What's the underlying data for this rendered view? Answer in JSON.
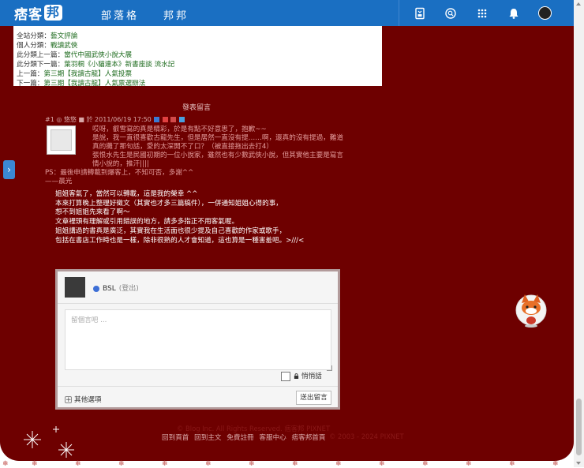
{
  "topbar": {
    "logo_text": "痞客",
    "logo_box": "邦",
    "nav": [
      "部落格",
      "邦邦"
    ],
    "icons": [
      "bookmark-icon",
      "search-icon",
      "apps-grid-icon",
      "notification-bell-icon",
      "user-avatar"
    ]
  },
  "info_panel": {
    "site_category_label": "全站分類：",
    "site_category": "藝文評論",
    "personal_category_label": "個人分類：",
    "personal_category": "戰讀武俠",
    "prev_in_category_label": "此分類上一篇：",
    "prev_in_category": "當代中國武俠小說大展",
    "next_in_category_label": "此分類下一篇：",
    "next_in_category": "葉羽桐《小貓連本》新書座談 流水記",
    "prev_label": "上一篇：",
    "prev": "第三期【我讀古龍】人氣投票",
    "next_label": "下一篇：",
    "next": "第三期【我讀古龍】人氣票選辦法"
  },
  "comments_title": "發表留言",
  "comment": {
    "meta": "#1 ◎ 悠悠 ■ 於 2011/06/19 17:50",
    "body": [
      "哎呀，叡雪寫的真是精彩，於是有點不好意思了，抱歉~~",
      "是說，我一直很喜歡古龍先生，但是居然一直沒有提……啊，還真的沒有提過，難道",
      "真的攤了那句話，愛的太深開不了口？（被直接拖出去打4）",
      "張恨水先生是民國初期的一位小說家，雖然也有少數武俠小說，但其實他主要是寫言",
      "情小說的，推汗||||"
    ],
    "ps": [
      "PS：最後申請轉載到爆客上，不知可否，多謝^^",
      "——晨光"
    ],
    "reply": [
      "姐姐客氣了，當然可以轉載，這是我的榮幸 ^^",
      "本來打算晚上整理好徵文（其實也才多三篇稿件），一併通知姐姐心得的事，",
      "想不到姐姐先來看了啊～",
      "文章裡頭有理解或引用錯誤的地方，請多多指正不用客氣喔。",
      "姐姐講過的書真是廣泛，其實我在生活面也很少提及自己喜歡的作家或歌手，",
      "包括在書店工作時也是一樣，除非很熟的人才會知道，這也算是一種害羞吧。>///<"
    ]
  },
  "reply_form": {
    "user_name": "BSL",
    "logout": "(登出)",
    "placeholder": "留個言吧 ...",
    "private_label": "悄悄話",
    "more_options": "其他選項",
    "submit": "送出留言"
  },
  "footer": {
    "dim_line": "© Blog Inc. All Rights Reserved. 痞客邦 PIXNET",
    "links": [
      "回到頁首",
      "回到主文",
      "免費註冊",
      "客服中心",
      "痞客邦首頁"
    ],
    "dim_tail": "© 2003 - 2024 PIXNET"
  },
  "colors": {
    "topbar": "#1a6fc2",
    "background": "#6e0000",
    "comment_text": "#e39b9b",
    "reply_text": "#ffffff",
    "link_green": "#1f6c1f"
  }
}
